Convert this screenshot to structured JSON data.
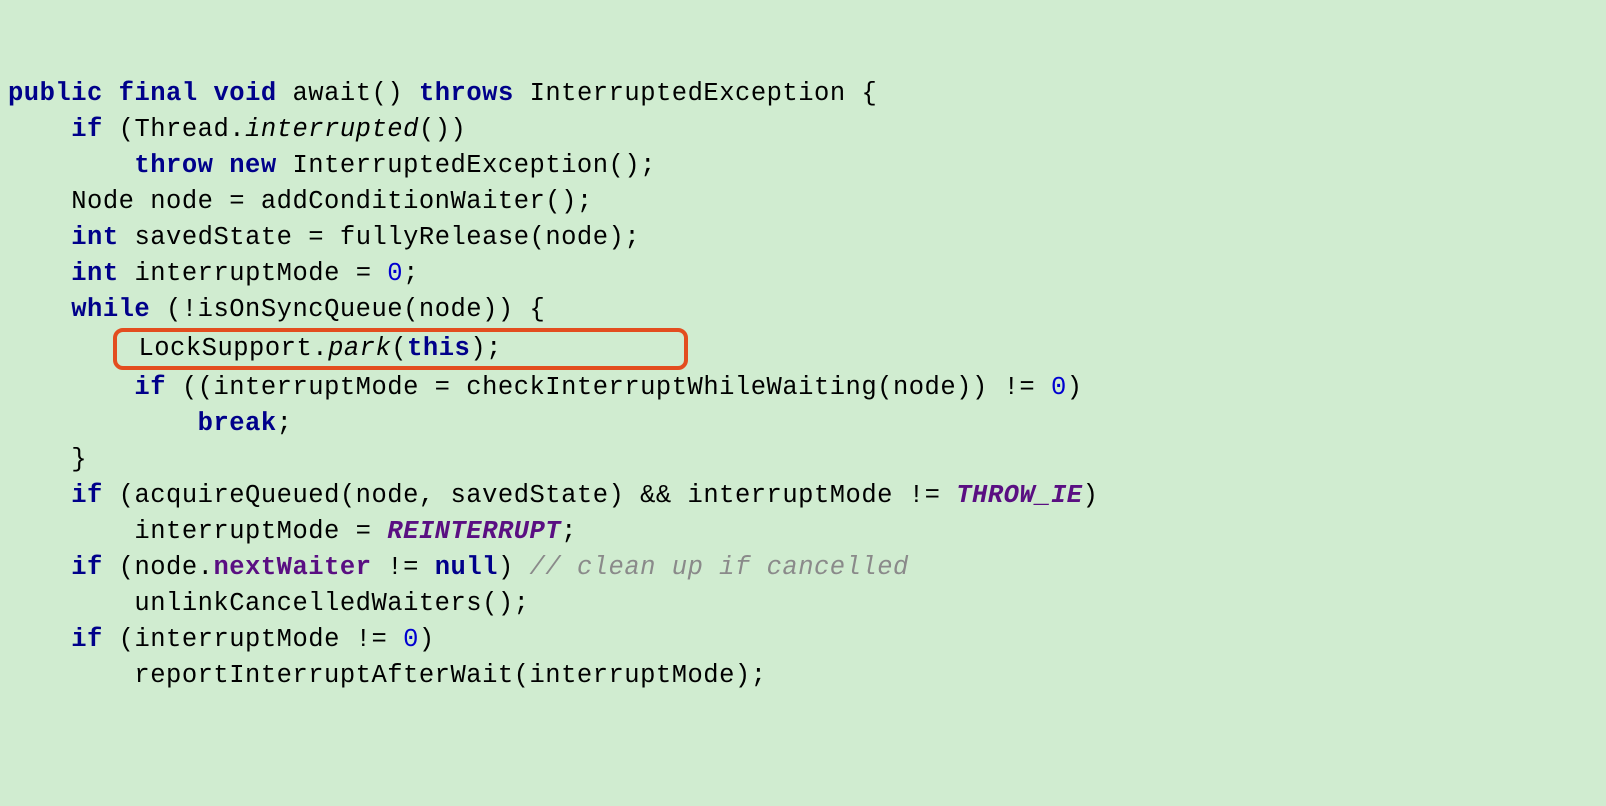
{
  "l1": {
    "kw_public": "public",
    "kw_final": "final",
    "kw_void": "void",
    "m": "await",
    "paren": "()",
    "kw_throws": "throws",
    "exc": "InterruptedException",
    "brace": "{"
  },
  "l2": {
    "kw_if": "if",
    "open": "(Thread.",
    "interrupted": "interrupted",
    "close": "())"
  },
  "l3": {
    "kw_throw": "throw",
    "kw_new": "new",
    "call": "InterruptedException();"
  },
  "l4": {
    "txt": "Node node = addConditionWaiter();"
  },
  "l5": {
    "kw_int": "int",
    "a": "savedState = fullyRelease(node);"
  },
  "l6": {
    "kw_int": "int",
    "a": "interruptMode = ",
    "zero": "0",
    "semi": ";"
  },
  "l7": {
    "kw_while": "while",
    "cond": "(!isOnSyncQueue(node)) {"
  },
  "l8": {
    "a": "LockSupport.",
    "park": "park",
    "b": "(",
    "kw_this": "this",
    "c": ");"
  },
  "l9": {
    "kw_if": "if",
    "a": "((interruptMode = checkInterruptWhileWaiting(node)) != ",
    "zero": "0",
    "b": ")"
  },
  "l10": {
    "kw_break": "break",
    "semi": ";"
  },
  "l11": {
    "brace": "}"
  },
  "l12": {
    "kw_if": "if",
    "a": "(acquireQueued(node, savedState) && interruptMode != ",
    "const": "THROW_IE",
    "b": ")"
  },
  "l13": {
    "a": "interruptMode = ",
    "const": "REINTERRUPT",
    "b": ";"
  },
  "l14": {
    "kw_if": "if",
    "a": "(node.",
    "field": "nextWaiter",
    "b": " != ",
    "kw_null": "null",
    "c": ") ",
    "comment": "// clean up if cancelled"
  },
  "l15": {
    "a": "unlinkCancelledWaiters();"
  },
  "l16": {
    "kw_if": "if",
    "a": "(interruptMode != ",
    "zero": "0",
    "b": ")"
  },
  "l17": {
    "a": "reportInterruptAfterWait(interruptMode);"
  }
}
